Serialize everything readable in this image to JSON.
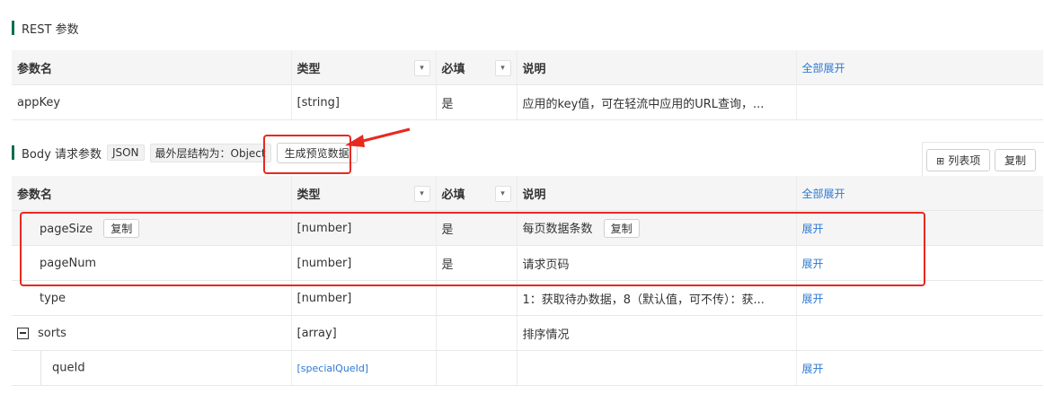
{
  "rest_section": {
    "title": "REST 参数"
  },
  "columns": {
    "name": "参数名",
    "type": "类型",
    "required": "必填",
    "desc": "说明",
    "expand_all": "全部展开"
  },
  "rest_rows": [
    {
      "name": "appKey",
      "type": "[string]",
      "required": "是",
      "desc": "应用的key值，可在轻流中应用的URL查询，..."
    }
  ],
  "body_section": {
    "title": "Body 请求参数",
    "format_tag": "JSON",
    "structure_tag": "最外层结构为：Object",
    "generate_button": "生成预览数据",
    "list_button": "列表项",
    "copy_button": "复制"
  },
  "body_rows": [
    {
      "name": "pageSize",
      "copy": "复制",
      "type": "[number]",
      "required": "是",
      "desc": "每页数据条数",
      "desc_copy": "复制",
      "action": "展开"
    },
    {
      "name": "pageNum",
      "type": "[number]",
      "required": "是",
      "desc": "请求页码",
      "action": "展开"
    },
    {
      "name": "type",
      "type": "[number]",
      "required": "",
      "desc": "1：获取待办数据，8（默认值，可不传）：获...",
      "action": "展开"
    },
    {
      "name": "sorts",
      "type": "[array]",
      "required": "",
      "desc": "排序情况",
      "action": ""
    },
    {
      "name": "queId",
      "type": "[specialQueId]",
      "required": "",
      "desc": "",
      "action": "展开"
    }
  ]
}
